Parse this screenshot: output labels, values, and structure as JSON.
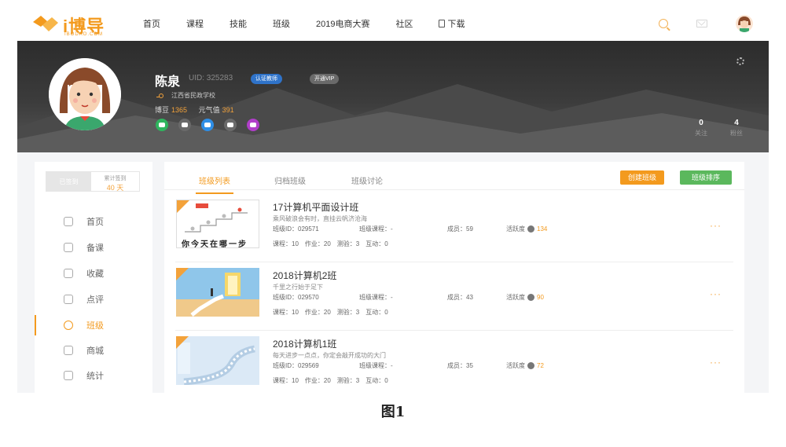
{
  "logo": {
    "text": "i博导",
    "sub": "IBODAO.COM"
  },
  "nav": [
    {
      "label": "首页"
    },
    {
      "label": "课程"
    },
    {
      "label": "技能"
    },
    {
      "label": "班级"
    },
    {
      "label": "2019电商大赛"
    },
    {
      "label": "社区"
    },
    {
      "label": "下载"
    }
  ],
  "profile": {
    "name": "陈泉",
    "uid": "UID: 325283",
    "teacher_badge": "认证教师",
    "vip_badge": "开通VIP",
    "school": "江西省民政学校",
    "bodou_label": "博豆",
    "bodou_value": "1365",
    "yuanqi_label": "元气值",
    "yuanqi_value": "391",
    "follow_count": "0",
    "follow_label": "关注",
    "fans_count": "4",
    "fans_label": "粉丝"
  },
  "socials": [
    {
      "icon": "wechat-icon",
      "color": "#2fb55e"
    },
    {
      "icon": "weibo-icon",
      "color": "#6a6a6a"
    },
    {
      "icon": "qq-icon",
      "color": "#2e8ee6"
    },
    {
      "icon": "mail-icon",
      "color": "#6a6a6a"
    },
    {
      "icon": "phone-icon",
      "color": "#b03ec9"
    }
  ],
  "checkin": {
    "done": "已签到",
    "total_label": "累计签到",
    "total_value": "40 天"
  },
  "sidebar": [
    {
      "label": "首页",
      "icon": "home-icon"
    },
    {
      "label": "备课",
      "icon": "prepare-icon"
    },
    {
      "label": "收藏",
      "icon": "star-icon"
    },
    {
      "label": "点评",
      "icon": "comment-icon"
    },
    {
      "label": "班级",
      "icon": "class-icon",
      "active": true
    },
    {
      "label": "商城",
      "icon": "shop-icon"
    },
    {
      "label": "统计",
      "icon": "stats-icon"
    }
  ],
  "tabs": [
    {
      "label": "班级列表",
      "active": true
    },
    {
      "label": "归档班级"
    },
    {
      "label": "班级讨论"
    }
  ],
  "buttons": {
    "create": "创建班级",
    "sort": "班级排序"
  },
  "classes": [
    {
      "name": "17计算机平面设计班",
      "desc": "乘风破浪会有时，直挂云帆济沧海",
      "class_id": "班级ID：029571",
      "class_course": "班级课程：-",
      "members": "成员：59",
      "activity_label": "活跃度",
      "activity_value": "134",
      "stats": "课程：10　作业：20　测验：3　互动：0",
      "thumb_text": "你今天在哪一步"
    },
    {
      "name": "2018计算机2班",
      "desc": "千里之行始于足下",
      "class_id": "班级ID：029570",
      "class_course": "班级课程：-",
      "members": "成员：43",
      "activity_label": "活跃度",
      "activity_value": "90",
      "stats": "课程：10　作业：20　测验：3　互动：0"
    },
    {
      "name": "2018计算机1班",
      "desc": "每天进步一点点，你定会敲开成功的大门",
      "class_id": "班级ID：029569",
      "class_course": "班级课程：-",
      "members": "成员：35",
      "activity_label": "活跃度",
      "activity_value": "72",
      "stats": "课程：10　作业：20　测验：3　互动：0"
    }
  ],
  "more_label": "···",
  "caption": "图1",
  "colors": {
    "accent": "#f39a1e",
    "green": "#5bb85d",
    "blue": "#2f73c9"
  }
}
